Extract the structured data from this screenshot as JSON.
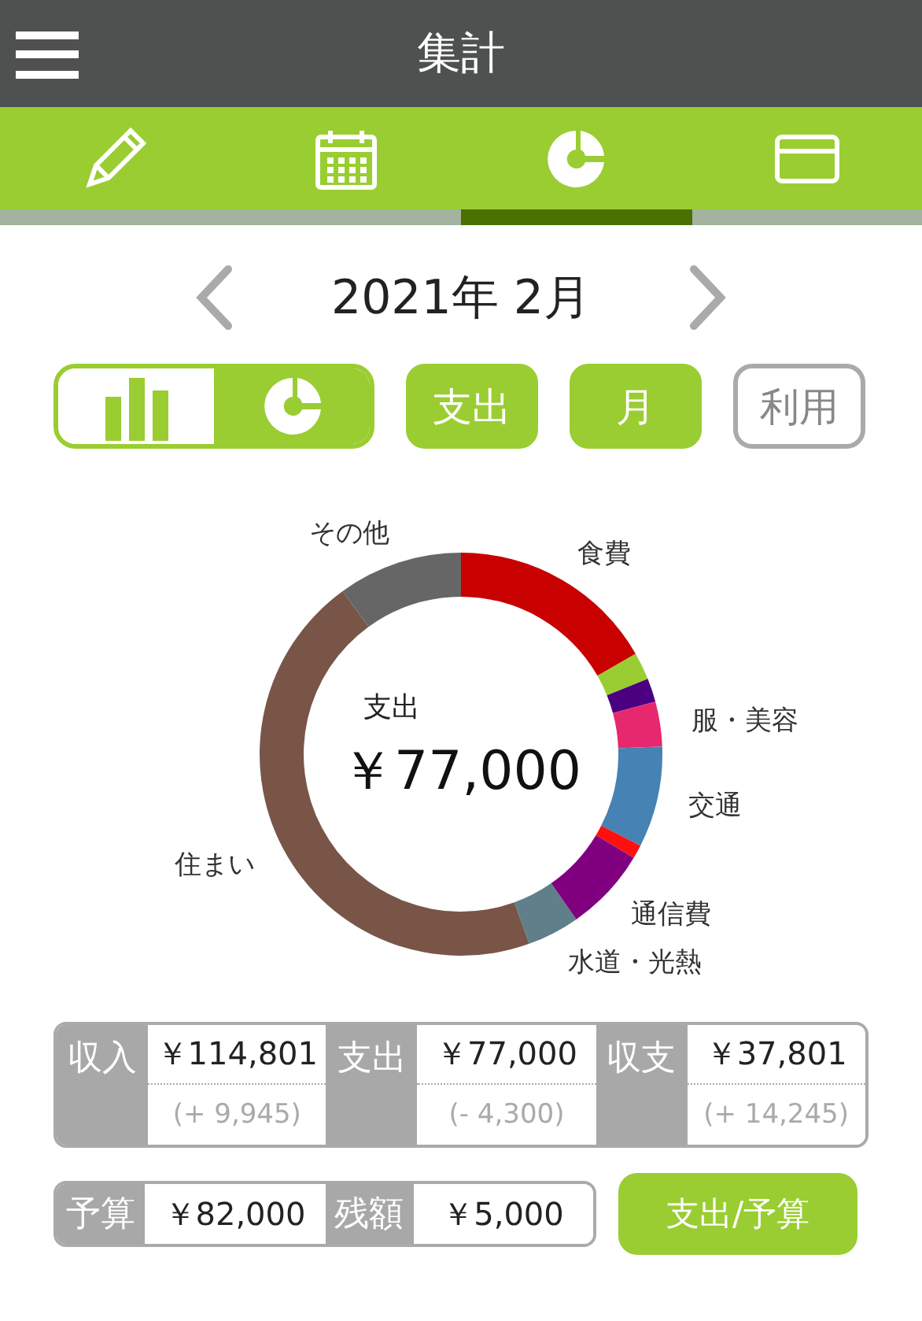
{
  "header": {
    "title": "集計"
  },
  "tabs": [
    {
      "kind": "pencil",
      "selected": false
    },
    {
      "kind": "calendar",
      "selected": false
    },
    {
      "kind": "donut",
      "selected": true
    },
    {
      "kind": "card",
      "selected": false
    }
  ],
  "period": {
    "label": "2021年 2月"
  },
  "view_toggle": [
    {
      "kind": "bar",
      "selected": false
    },
    {
      "kind": "donut",
      "selected": true
    }
  ],
  "filters": [
    {
      "label": "支出",
      "on": true
    },
    {
      "label": "月",
      "on": true
    },
    {
      "label": "利用",
      "on": false
    }
  ],
  "chart": {
    "center_label": "支出",
    "center_value": "￥77,000",
    "chart_data": {
      "type": "donut",
      "categories": [
        "食費",
        null,
        null,
        "服・美容",
        "交通",
        null,
        "通信費",
        "水道・光熱",
        "住まい",
        "その他"
      ],
      "colors": [
        "#c80000",
        "#9acd32",
        "#4b0082",
        "#e8286e",
        "#4682b4",
        "#ff1010",
        "#800080",
        "#5f7f8a",
        "#795548",
        "#666666"
      ],
      "series": [
        {
          "values": [
            16.7,
            2.2,
            1.9,
            3.6,
            8.1,
            1.1,
            6.7,
            4.2,
            45.5,
            10
          ]
        }
      ]
    }
  },
  "totals": [
    {
      "label": "収入",
      "value": "￥114,801",
      "change": "(+ 9,945)"
    },
    {
      "label": "支出",
      "value": "￥77,000",
      "change": "(- 4,300)"
    },
    {
      "label": "収支",
      "value": "￥37,801",
      "change": "(+ 14,245)"
    }
  ],
  "budget": [
    {
      "label": "予算",
      "value": "￥82,000"
    },
    {
      "label": "残額",
      "value": "￥5,000"
    }
  ],
  "budget_button": {
    "label": "支出/予算"
  }
}
